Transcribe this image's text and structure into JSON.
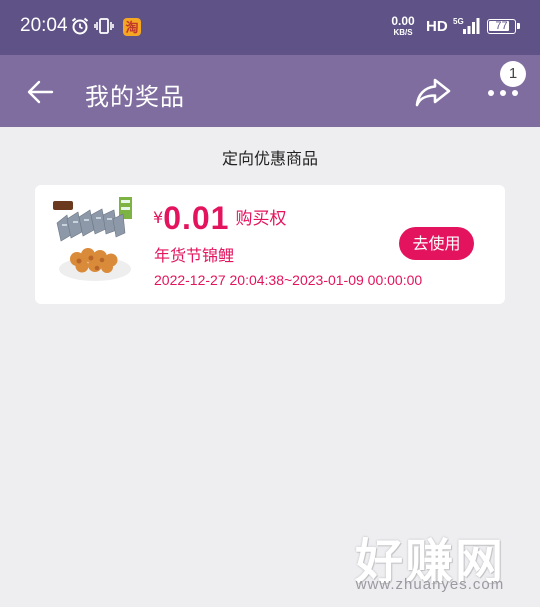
{
  "status_bar": {
    "time": "20:04",
    "net_speed_value": "0.00",
    "net_speed_unit": "KB/S",
    "hd_label": "HD",
    "network_type": "5G",
    "battery_level": "77",
    "icons": [
      "alarm-icon",
      "vibrate-icon",
      "taobao-icon",
      "signal-icon",
      "battery-icon"
    ]
  },
  "app_bar": {
    "title": "我的奖品",
    "notification_count": "1",
    "icons": [
      "back-arrow-icon",
      "share-icon",
      "more-icon"
    ]
  },
  "section_title": "定向优惠商品",
  "coupon": {
    "currency": "¥",
    "amount": "0.01",
    "type_label": "购买权",
    "product_name": "年货节锦鲤",
    "validity": "2022-12-27 20:04:38~2023-01-09 00:00:00",
    "use_button": "去使用",
    "accent_color": "#e3145d"
  },
  "watermark": {
    "logo_text": "好赚网",
    "url": "www.zhuanyes.com"
  },
  "colors": {
    "status_bar": "#5f5287",
    "app_bar": "#7f6d9f",
    "background": "#eeedf0"
  }
}
